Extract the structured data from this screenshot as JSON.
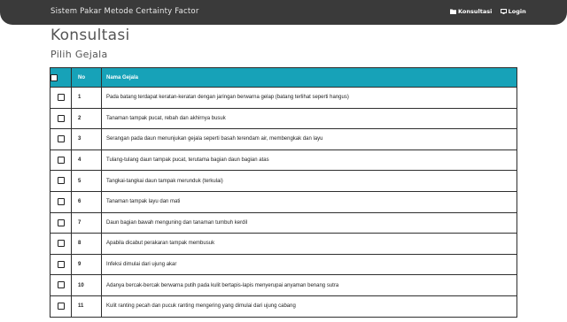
{
  "navbar": {
    "brand": "Sistem Pakar Metode Certainty Factor",
    "links": [
      {
        "label": "Konsultasi",
        "icon": "folder-icon"
      },
      {
        "label": "Login",
        "icon": "monitor-icon"
      }
    ]
  },
  "page": {
    "title": "Konsultasi",
    "subtitle": "Pilih Gejala"
  },
  "table": {
    "header_color": "#17a2b8",
    "columns": [
      "",
      "No",
      "Nama Gejala"
    ],
    "rows": [
      {
        "no": "1",
        "name": "Pada batang terdapat keratan-keratan dengan jaringan berwarna gelap (batang terlihat seperti hangus)"
      },
      {
        "no": "2",
        "name": "Tanaman tampak pucat, rebah dan akhirnya busuk"
      },
      {
        "no": "3",
        "name": "Serangan pada daun menunjukan gejala seperti basah terendam air, membengkak dan layu"
      },
      {
        "no": "4",
        "name": "Tulang-tulang daun tampak pucat, terutama bagian daun bagian atas"
      },
      {
        "no": "5",
        "name": "Tangkai-tangkai daun tampak merunduk (terkulai)"
      },
      {
        "no": "6",
        "name": "Tanaman tampak layu dan mati"
      },
      {
        "no": "7",
        "name": "Daun bagian bawah menguning dan tanaman tumbuh kerdil"
      },
      {
        "no": "8",
        "name": "Apabila dicabut perakaran tampak membusuk"
      },
      {
        "no": "9",
        "name": "Infeksi dimulai dari ujung akar"
      },
      {
        "no": "10",
        "name": "Adanya bercak-bercak berwarna putih pada kulit bertapis-lapis menyerupai anyaman benang sutra"
      },
      {
        "no": "11",
        "name": "Kulit ranting pecah dan pucuk ranting mengering yang dimulai dari ujung cabang"
      }
    ]
  }
}
